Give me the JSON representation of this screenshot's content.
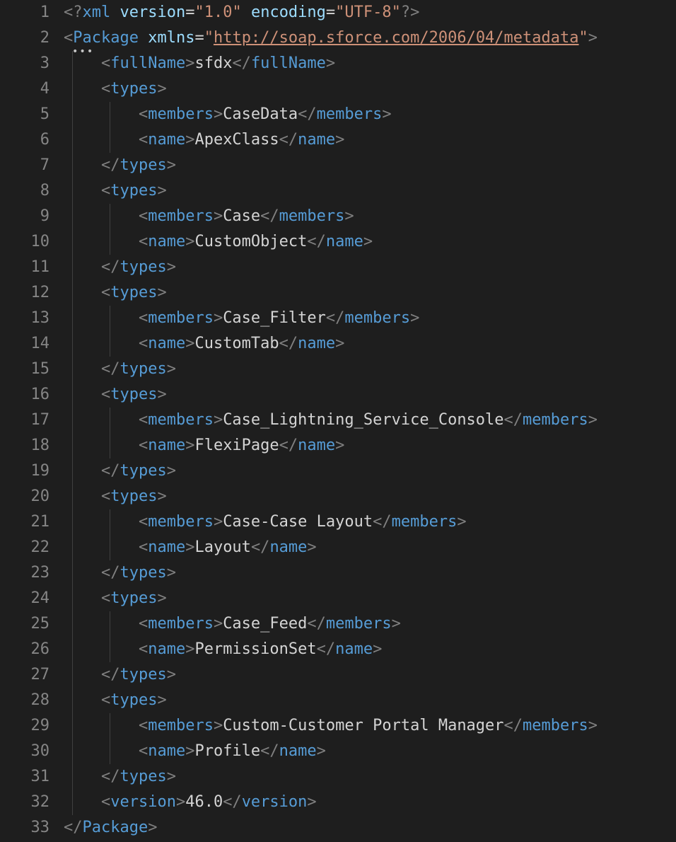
{
  "xmlDecl": {
    "version": "1.0",
    "encoding": "UTF-8"
  },
  "rootTag": "Package",
  "xmlnsAttr": "xmlns",
  "xmlnsValue": "http://soap.sforce.com/2006/04/metadata",
  "fullNameTag": "fullName",
  "fullNameValue": "sfdx",
  "typesTag": "types",
  "membersTag": "members",
  "nameTag": "name",
  "versionTag": "version",
  "versionValue": "46.0",
  "types": [
    {
      "members": "CaseData",
      "name": "ApexClass"
    },
    {
      "members": "Case",
      "name": "CustomObject"
    },
    {
      "members": "Case_Filter",
      "name": "CustomTab"
    },
    {
      "members": "Case_Lightning_Service_Console",
      "name": "FlexiPage"
    },
    {
      "members": "Case-Case Layout",
      "name": "Layout"
    },
    {
      "members": "Case_Feed",
      "name": "PermissionSet"
    },
    {
      "members": "Custom-Customer Portal Manager",
      "name": "Profile"
    }
  ],
  "lineNumbers": [
    "1",
    "2",
    "3",
    "4",
    "5",
    "6",
    "7",
    "8",
    "9",
    "10",
    "11",
    "12",
    "13",
    "14",
    "15",
    "16",
    "17",
    "18",
    "19",
    "20",
    "21",
    "22",
    "23",
    "24",
    "25",
    "26",
    "27",
    "28",
    "29",
    "30",
    "31",
    "32",
    "33"
  ]
}
